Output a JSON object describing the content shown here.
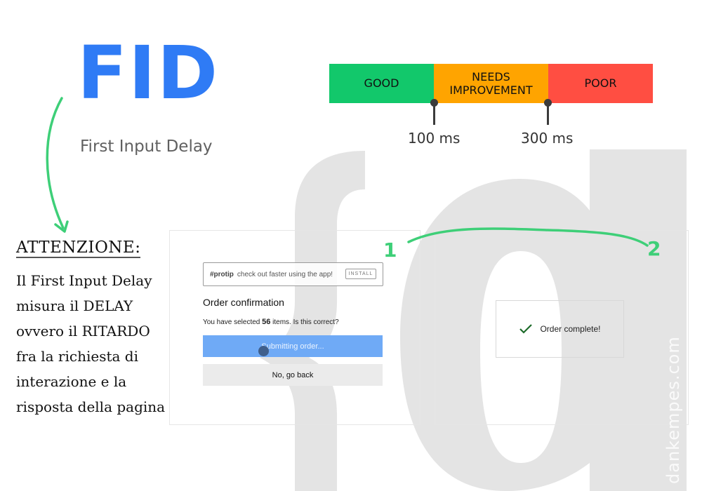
{
  "header": {
    "acronym": "FID",
    "subtitle": "First Input Delay"
  },
  "thresholds": {
    "segments": [
      {
        "label": "GOOD",
        "color": "#12c86b"
      },
      {
        "label": "NEEDS IMPROVEMENT",
        "color": "#ffa400"
      },
      {
        "label": "POOR",
        "color": "#ff4e42"
      }
    ],
    "markers": [
      {
        "label": "100 ms",
        "value_ms": 100
      },
      {
        "label": "300 ms",
        "value_ms": 300
      }
    ]
  },
  "note": {
    "title": "ATTENZIONE:",
    "lines": [
      "Il First Input Delay",
      "misura il DELAY",
      "ovvero il RITARDO",
      "fra la richiesta di",
      "interazione e la",
      "risposta della pagina"
    ]
  },
  "step_labels": [
    "1",
    "2"
  ],
  "screen_1": {
    "protip_tag": "#protip",
    "protip_text": "check out faster using the app!",
    "install_label": "INSTALL",
    "heading": "Order confirmation",
    "question_prefix": "You have selected ",
    "item_count": "56",
    "question_suffix": " items. Is this correct?",
    "submit_label": "Submitting order...",
    "back_label": "No, go back"
  },
  "screen_2": {
    "status_icon": "checkmark-icon",
    "status_text": "Order complete!"
  },
  "watermark": "dankempes.com",
  "colors": {
    "brand_blue": "#2f7bf5",
    "annotation_green": "#3ecf78"
  }
}
